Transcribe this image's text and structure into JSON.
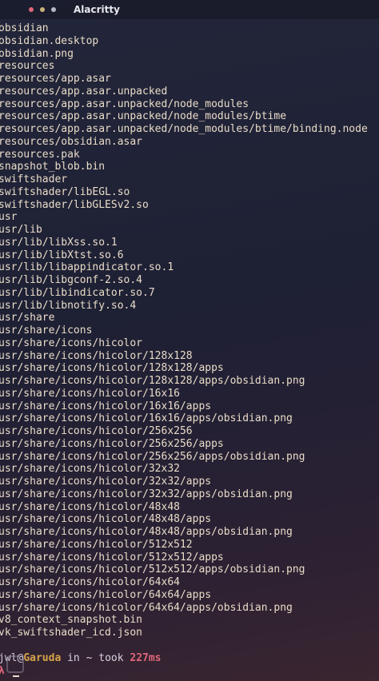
{
  "window": {
    "title": "Alacritty",
    "controls": {
      "close_color": "#e0657a",
      "minimize_color": "#c9b27a",
      "maximize_color": "#b8b8c8"
    }
  },
  "output_lines": [
    "obsidian",
    "obsidian.desktop",
    "obsidian.png",
    "resources",
    "resources/app.asar",
    "resources/app.asar.unpacked",
    "resources/app.asar.unpacked/node_modules",
    "resources/app.asar.unpacked/node_modules/btime",
    "resources/app.asar.unpacked/node_modules/btime/binding.node",
    "resources/obsidian.asar",
    "resources.pak",
    "snapshot_blob.bin",
    "swiftshader",
    "swiftshader/libEGL.so",
    "swiftshader/libGLESv2.so",
    "usr",
    "usr/lib",
    "usr/lib/libXss.so.1",
    "usr/lib/libXtst.so.6",
    "usr/lib/libappindicator.so.1",
    "usr/lib/libgconf-2.so.4",
    "usr/lib/libindicator.so.7",
    "usr/lib/libnotify.so.4",
    "usr/share",
    "usr/share/icons",
    "usr/share/icons/hicolor",
    "usr/share/icons/hicolor/128x128",
    "usr/share/icons/hicolor/128x128/apps",
    "usr/share/icons/hicolor/128x128/apps/obsidian.png",
    "usr/share/icons/hicolor/16x16",
    "usr/share/icons/hicolor/16x16/apps",
    "usr/share/icons/hicolor/16x16/apps/obsidian.png",
    "usr/share/icons/hicolor/256x256",
    "usr/share/icons/hicolor/256x256/apps",
    "usr/share/icons/hicolor/256x256/apps/obsidian.png",
    "usr/share/icons/hicolor/32x32",
    "usr/share/icons/hicolor/32x32/apps",
    "usr/share/icons/hicolor/32x32/apps/obsidian.png",
    "usr/share/icons/hicolor/48x48",
    "usr/share/icons/hicolor/48x48/apps",
    "usr/share/icons/hicolor/48x48/apps/obsidian.png",
    "usr/share/icons/hicolor/512x512",
    "usr/share/icons/hicolor/512x512/apps",
    "usr/share/icons/hicolor/512x512/apps/obsidian.png",
    "usr/share/icons/hicolor/64x64",
    "usr/share/icons/hicolor/64x64/apps",
    "usr/share/icons/hicolor/64x64/apps/obsidian.png",
    "v8_context_snapshot.bin",
    "vk_swiftshader_icd.json"
  ],
  "prompt": {
    "user": "jwl",
    "at": "@",
    "host": "Garuda",
    "text": " in ~ took ",
    "duration": "227ms",
    "symbol": "λ",
    "host_color": "#d8a44a",
    "duration_color": "#e0657a"
  }
}
